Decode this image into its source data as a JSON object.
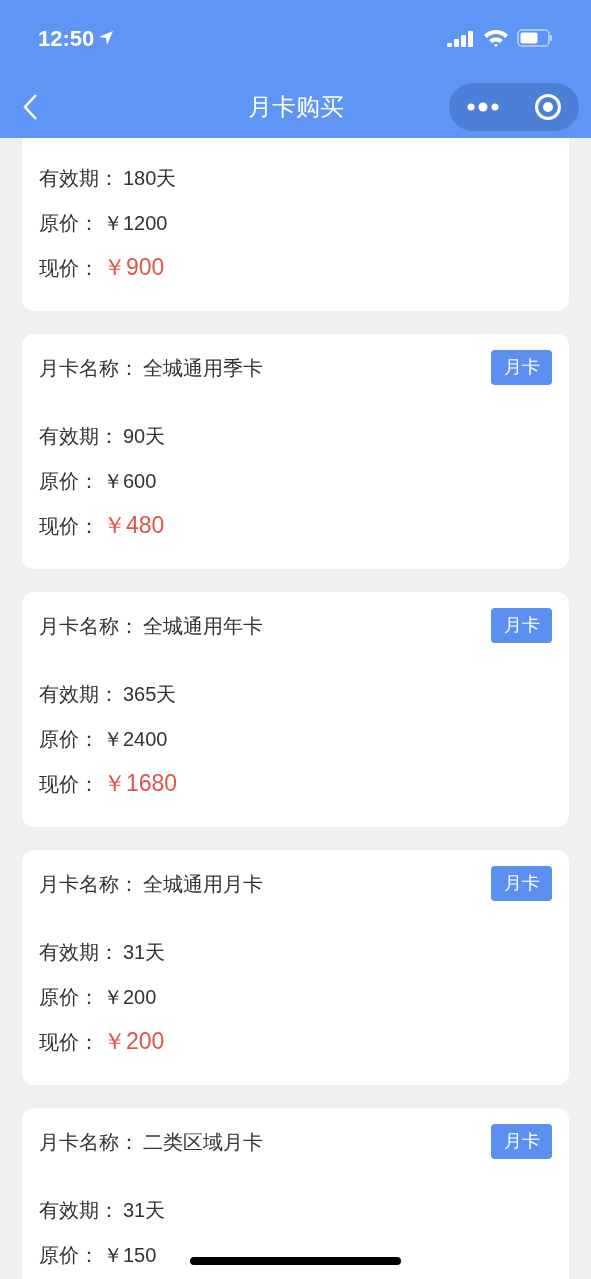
{
  "status_bar": {
    "time": "12:50"
  },
  "nav": {
    "title": "月卡购买"
  },
  "cards": [
    {
      "validity": {
        "label": "有效期：",
        "value": "180天"
      },
      "original_price": {
        "label": "原价：",
        "value": "￥1200"
      },
      "current_price": {
        "label": "现价：",
        "value": "￥900"
      }
    },
    {
      "name": {
        "label": "月卡名称：",
        "value": "全城通用季卡"
      },
      "tag": "月卡",
      "validity": {
        "label": "有效期：",
        "value": "90天"
      },
      "original_price": {
        "label": "原价：",
        "value": "￥600"
      },
      "current_price": {
        "label": "现价：",
        "value": "￥480"
      }
    },
    {
      "name": {
        "label": "月卡名称：",
        "value": "全城通用年卡"
      },
      "tag": "月卡",
      "validity": {
        "label": "有效期：",
        "value": "365天"
      },
      "original_price": {
        "label": "原价：",
        "value": "￥2400"
      },
      "current_price": {
        "label": "现价：",
        "value": "￥1680"
      }
    },
    {
      "name": {
        "label": "月卡名称：",
        "value": "全城通用月卡"
      },
      "tag": "月卡",
      "validity": {
        "label": "有效期：",
        "value": "31天"
      },
      "original_price": {
        "label": "原价：",
        "value": "￥200"
      },
      "current_price": {
        "label": "现价：",
        "value": "￥200"
      }
    },
    {
      "name": {
        "label": "月卡名称：",
        "value": "二类区域月卡"
      },
      "tag": "月卡",
      "validity": {
        "label": "有效期：",
        "value": "31天"
      },
      "original_price": {
        "label": "原价：",
        "value": "￥150"
      }
    }
  ]
}
